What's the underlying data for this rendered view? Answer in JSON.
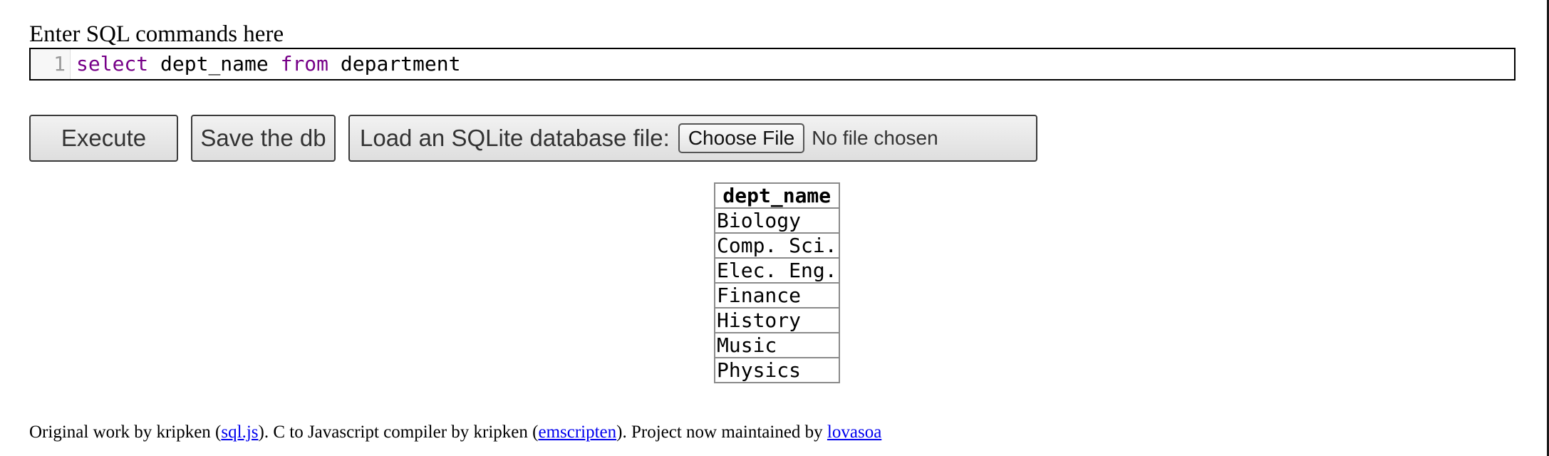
{
  "prompt": {
    "label": "Enter SQL commands here"
  },
  "editor": {
    "line_number": "1",
    "tokens": {
      "kw_select": "select",
      "col": " dept_name ",
      "kw_from": "from",
      "table": " department"
    }
  },
  "toolbar": {
    "execute_label": "Execute",
    "save_label": "Save the db",
    "load_label": "Load an SQLite database file:",
    "choose_file_label": "Choose File",
    "no_file_text": "No file chosen"
  },
  "results": {
    "columns": [
      "dept_name"
    ],
    "rows": [
      [
        "Biology"
      ],
      [
        "Comp. Sci."
      ],
      [
        "Elec. Eng."
      ],
      [
        "Finance"
      ],
      [
        "History"
      ],
      [
        "Music"
      ],
      [
        "Physics"
      ]
    ]
  },
  "footer": {
    "text_1": "Original work by kripken (",
    "link_sqljs": "sql.js",
    "text_2": "). C to Javascript compiler by kripken (",
    "link_emscripten": "emscripten",
    "text_3": "). Project now maintained by ",
    "link_lovasoa": "lovasoa"
  },
  "colors": {
    "keyword": "#770088",
    "link": "#0000ee",
    "gutter_text": "#999999"
  }
}
